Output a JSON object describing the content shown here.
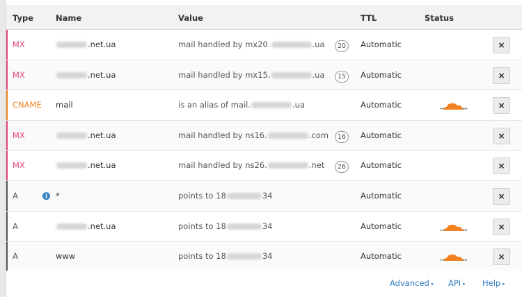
{
  "colors": {
    "MX": "#e0457b",
    "CNAME": "#f38020",
    "A": "#555555",
    "link": "#2f7bbf",
    "cloud": "#f38020"
  },
  "header": {
    "type": "Type",
    "name": "Name",
    "value": "Value",
    "ttl": "TTL",
    "status": "Status"
  },
  "rows": [
    {
      "type": "MX",
      "name_pre": "",
      "name_post": ".net.ua",
      "value_pre": "mail handled by mx20.",
      "value_post": ".ua",
      "priority": "20",
      "ttl": "Automatic",
      "cloud": false,
      "info": false
    },
    {
      "type": "MX",
      "name_pre": "",
      "name_post": ".net.ua",
      "value_pre": "mail handled by mx15.",
      "value_post": ".ua",
      "priority": "15",
      "ttl": "Automatic",
      "cloud": false,
      "info": false
    },
    {
      "type": "CNAME",
      "name_pre": "mail",
      "name_post": "",
      "value_pre": "is an alias of mail.",
      "value_post": ".ua",
      "priority": "",
      "ttl": "Automatic",
      "cloud": true,
      "info": false
    },
    {
      "type": "MX",
      "name_pre": "",
      "name_post": ".net.ua",
      "value_pre": "mail handled by ns16.",
      "value_post": ".com",
      "priority": "16",
      "ttl": "Automatic",
      "cloud": false,
      "info": false
    },
    {
      "type": "MX",
      "name_pre": "",
      "name_post": ".net.ua",
      "value_pre": "mail handled by ns26.",
      "value_post": ".net",
      "priority": "26",
      "ttl": "Automatic",
      "cloud": false,
      "info": false
    },
    {
      "type": "A",
      "name_pre": "*",
      "name_post": "",
      "value_pre": "points to 18",
      "value_post": "34",
      "priority": "",
      "ttl": "Automatic",
      "cloud": false,
      "info": true
    },
    {
      "type": "A",
      "name_pre": "",
      "name_post": ".net.ua",
      "value_pre": "points to 18",
      "value_post": "34",
      "priority": "",
      "ttl": "Automatic",
      "cloud": true,
      "info": false
    },
    {
      "type": "A",
      "name_pre": "www",
      "name_post": "",
      "value_pre": "points to 18",
      "value_post": "34",
      "priority": "",
      "ttl": "Automatic",
      "cloud": true,
      "info": false
    }
  ],
  "delete_label": "×",
  "info_label": "i",
  "footer": {
    "advanced": "Advanced",
    "api": "API",
    "help": "Help",
    "arrow": "▸"
  }
}
